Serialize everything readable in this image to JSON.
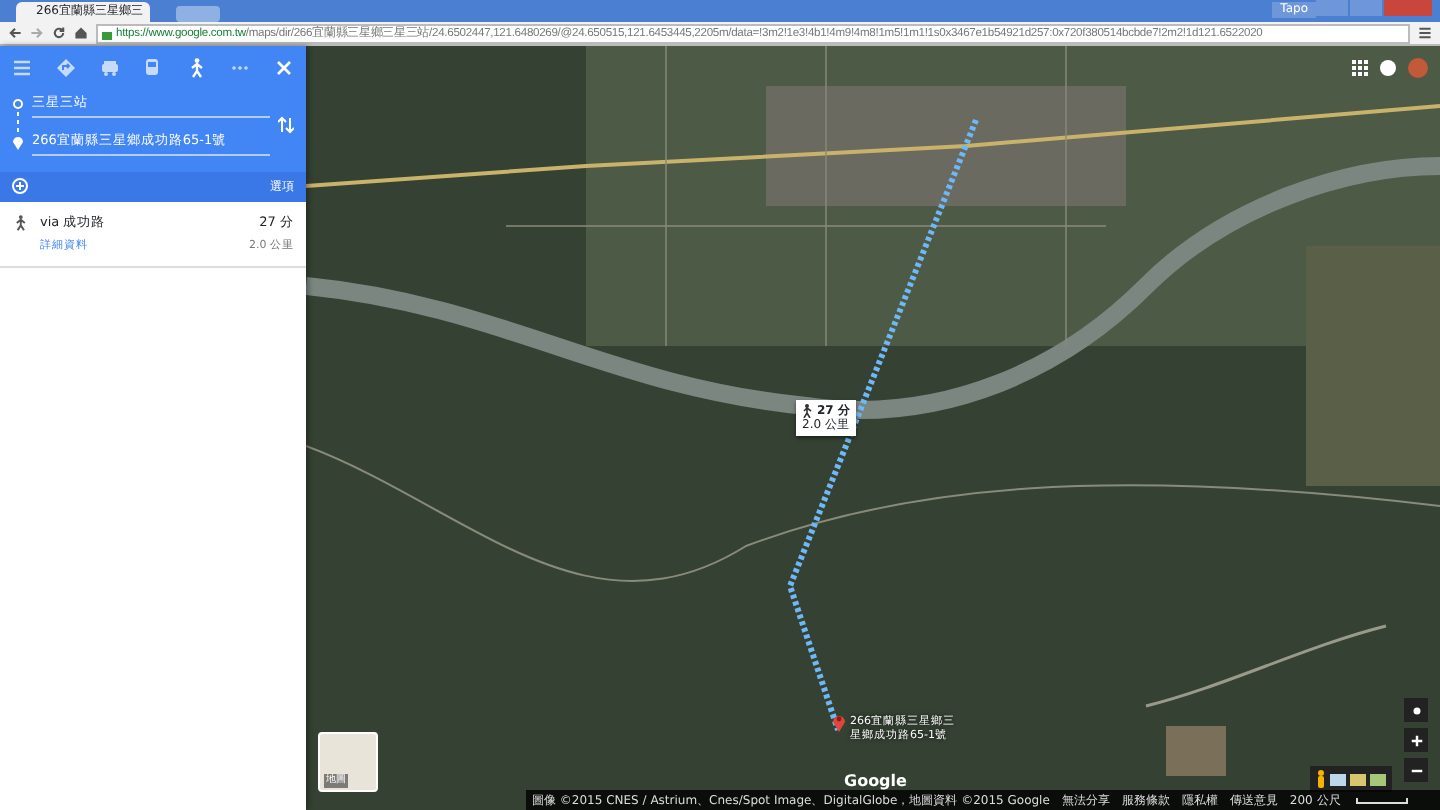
{
  "browser": {
    "tab_title": "266宜蘭縣三星鄉三",
    "user_label": "Tapo",
    "url_host": "https://www.google.com.tw",
    "url_path": "/maps/dir/266宜蘭縣三星鄉三星三站/24.6502447,121.6480269/@24.650515,121.6453445,2205m/data=!3m2!1e3!4b1!4m9!4m8!1m5!1m1!1s0x3467e1b54921d257:0x720f380514bcbde7!2m2!1d121.6522020"
  },
  "directions": {
    "modes": [
      {
        "kind": "menu",
        "selected": false
      },
      {
        "kind": "best",
        "selected": false
      },
      {
        "kind": "drive",
        "selected": false
      },
      {
        "kind": "transit",
        "selected": false
      },
      {
        "kind": "walk",
        "selected": true
      },
      {
        "kind": "more",
        "selected": false
      }
    ],
    "origin": "三星三站",
    "destination": "266宜蘭縣三星鄉成功路65-1號",
    "options_label": "選項",
    "routes": [
      {
        "via": "via 成功路",
        "duration": "27 分",
        "distance": "2.0 公里",
        "details_link": "詳細資料"
      }
    ]
  },
  "map": {
    "route_popup": {
      "duration": "27 分",
      "distance": "2.0 公里"
    },
    "destination_label": "266宜蘭縣三星鄉三星鄉成功路65-1號",
    "logo": "Google",
    "map_type_label": "地圖",
    "attribution": "圖像 ©2015 CNES / Astrium、Cnes/Spot Image、DigitalGlobe，地圖資料 ©2015 Google",
    "footer_links": [
      "無法分享",
      "服務條款",
      "隱私權",
      "傳送意見"
    ],
    "scale": "200 公尺"
  }
}
